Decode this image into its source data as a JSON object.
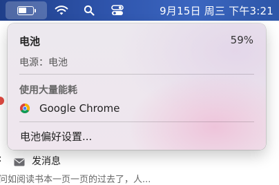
{
  "menubar": {
    "battery_icon": "battery-icon",
    "battery_level": 0.59,
    "wifi_icon": "wifi-icon",
    "search_icon": "spotlight-search-icon",
    "control_center_icon": "control-center-icon",
    "clock": "9月15日 周三 下午3:21"
  },
  "battery_menu": {
    "title": "电池",
    "percent": "59%",
    "power_source": "电源：电池",
    "heavy_usage_heading": "使用大量能耗",
    "apps": [
      {
        "name": "Google Chrome",
        "icon": "chrome-icon"
      }
    ],
    "preferences_label": "电池偏好设置..."
  },
  "background_app": {
    "message_icon": "mail-icon",
    "message_label": "发消息",
    "snippet": "问如阅读书本一页一页的过去了，人..."
  },
  "colors": {
    "menubar": "#2f55ad",
    "panel": "#ece8ee",
    "notification_dot": "#e04a42"
  }
}
